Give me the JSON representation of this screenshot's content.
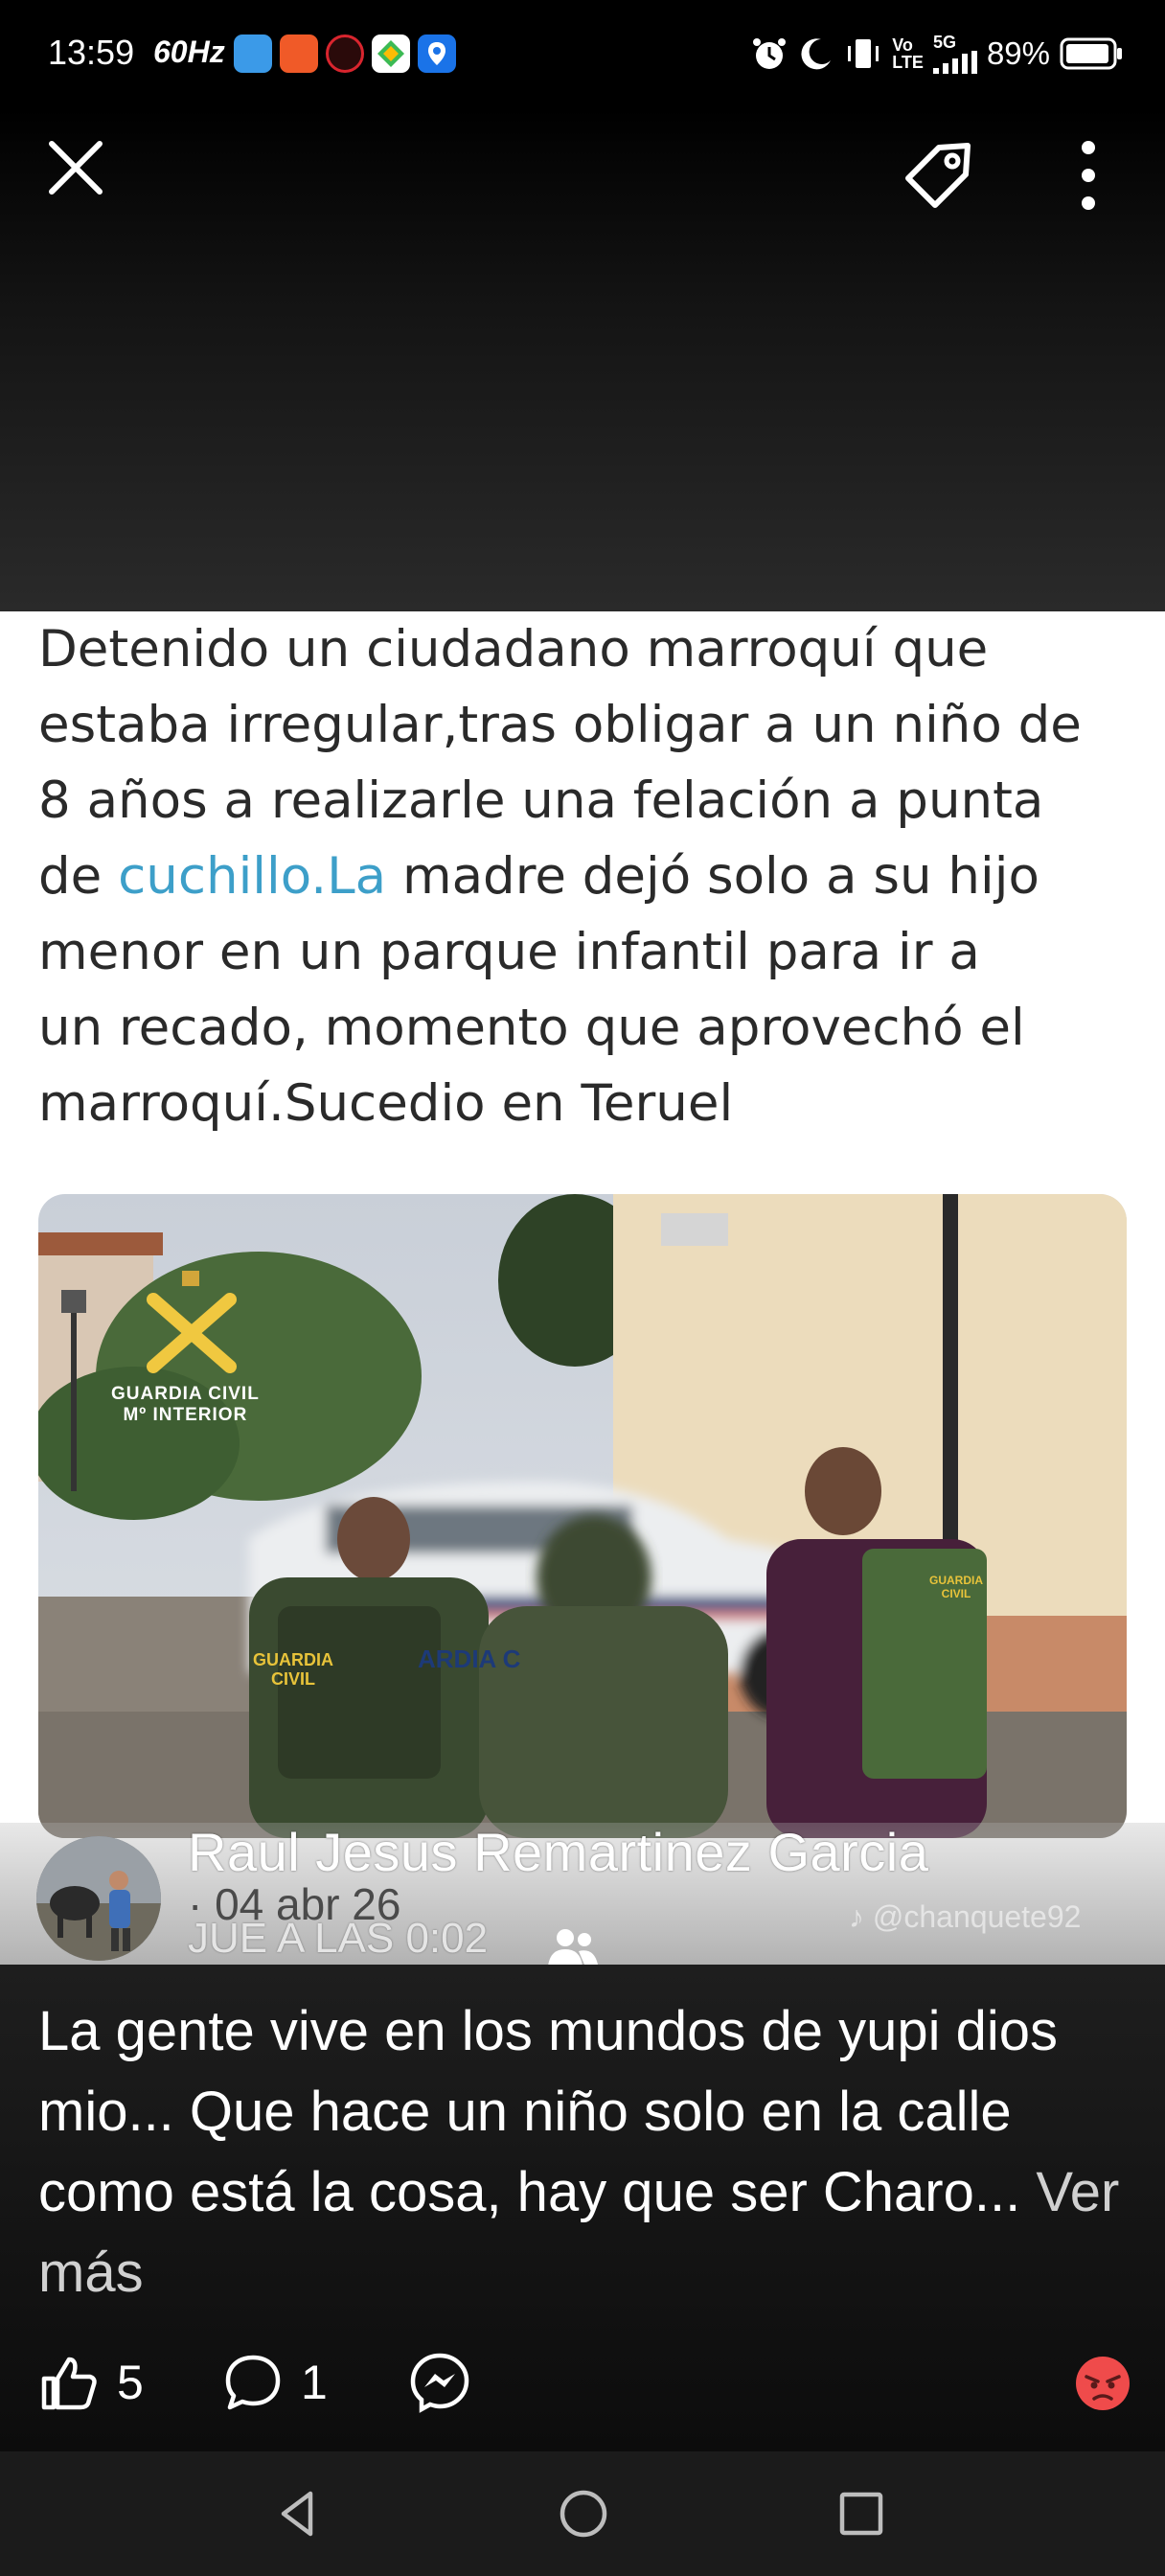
{
  "status_bar": {
    "time": "13:59",
    "refresh_rate": "60Hz",
    "network_top": "Vo",
    "network_bottom": "LTE",
    "network_gen": "5G",
    "battery": "89%",
    "app_icons": [
      "clock-app-icon",
      "puzzle-app-icon",
      "opera-app-icon",
      "maps-app-icon",
      "location-app-icon"
    ],
    "app_colors": [
      "#3b9ae8",
      "#f05a28",
      "#d9252e",
      "#ffffff",
      "#1a73e8"
    ]
  },
  "toolbar": {
    "close_icon": "close-icon",
    "tag_icon": "tag-icon",
    "more_icon": "more-vertical-icon"
  },
  "shared_image": {
    "text_lines": [
      "Detenido un ciudadano marroquí que",
      "estaba irregular,tras obligar a un niño de",
      "8 años a realizarle una felación a punta",
      "de ",
      "cuchillo.La",
      " madre dejó solo a su hijo",
      "menor en un parque infantil para ir a",
      "un recado, momento que aprovechó el",
      "marroquí.Sucedio en Teruel"
    ],
    "photo": {
      "badge_line1": "GUARDIA CIVIL",
      "badge_line2": "Mº INTERIOR",
      "car_text": "ARDIA C",
      "vest_left": "GUARDIA CIVIL",
      "vest_right": "GUARDIA CIVIL"
    },
    "author_name": "Raul Jesus Remartinez Garcia",
    "author_date": "· 04 abr 26",
    "author_sub": "JUE A LAS 0:02",
    "watermark": "♪ @chanquete92"
  },
  "caption": {
    "text": "La gente vive en los mundos de yupi dios mio... Que hace un niño solo en la calle como está la cosa, hay que ser Charo... ",
    "more": "Ver más"
  },
  "actions": {
    "likes": "5",
    "comments": "1"
  },
  "colors": {
    "link": "#3d9fc9",
    "angry_reaction": "#ef4b4b"
  }
}
